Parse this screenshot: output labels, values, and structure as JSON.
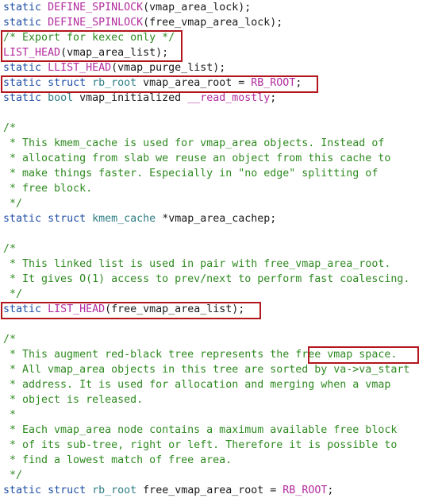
{
  "colors": {
    "keyword": "#1f4fa5",
    "macro": "#b22c9e",
    "type": "#2e7d84",
    "comment": "#2f8a21",
    "text": "#1a1a1a",
    "highlight_box": "#b3161d",
    "background": "#ffffff"
  },
  "lines": [
    [
      [
        "kw",
        "static"
      ],
      [
        "op",
        " "
      ],
      [
        "mac",
        "DEFINE_SPINLOCK"
      ],
      [
        "pn",
        "(vmap_area_lock);"
      ]
    ],
    [
      [
        "kw",
        "static"
      ],
      [
        "op",
        " "
      ],
      [
        "mac",
        "DEFINE_SPINLOCK"
      ],
      [
        "pn",
        "(free_vmap_area_lock);"
      ]
    ],
    [
      [
        "cmt",
        "/* Export for kexec only */"
      ]
    ],
    [
      [
        "mac",
        "LIST_HEAD"
      ],
      [
        "pn",
        "(vmap_area_list);"
      ]
    ],
    [
      [
        "kw",
        "static"
      ],
      [
        "op",
        " "
      ],
      [
        "mac",
        "LLIST_HEAD"
      ],
      [
        "pn",
        "(vmap_purge_list);"
      ]
    ],
    [
      [
        "kw",
        "static"
      ],
      [
        "op",
        " "
      ],
      [
        "kw",
        "struct"
      ],
      [
        "op",
        " "
      ],
      [
        "typ",
        "rb_root"
      ],
      [
        "pn",
        " vmap_area_root = "
      ],
      [
        "mac",
        "RB_ROOT"
      ],
      [
        "pn",
        ";"
      ]
    ],
    [
      [
        "kw",
        "static"
      ],
      [
        "op",
        " "
      ],
      [
        "typ",
        "bool"
      ],
      [
        "pn",
        " vmap_initialized "
      ],
      [
        "mac",
        "__read_mostly"
      ],
      [
        "pn",
        ";"
      ]
    ],
    [
      [
        "op",
        ""
      ]
    ],
    [
      [
        "cmt",
        "/*"
      ]
    ],
    [
      [
        "cmt",
        " * This kmem_cache is used for vmap_area objects. Instead of"
      ]
    ],
    [
      [
        "cmt",
        " * allocating from slab we reuse an object from this cache to"
      ]
    ],
    [
      [
        "cmt",
        " * make things faster. Especially in \"no edge\" splitting of"
      ]
    ],
    [
      [
        "cmt",
        " * free block."
      ]
    ],
    [
      [
        "cmt",
        " */"
      ]
    ],
    [
      [
        "kw",
        "static"
      ],
      [
        "op",
        " "
      ],
      [
        "kw",
        "struct"
      ],
      [
        "op",
        " "
      ],
      [
        "typ",
        "kmem_cache"
      ],
      [
        "pn",
        " *vmap_area_cachep;"
      ]
    ],
    [
      [
        "op",
        ""
      ]
    ],
    [
      [
        "cmt",
        "/*"
      ]
    ],
    [
      [
        "cmt",
        " * This linked list is used in pair with free_vmap_area_root."
      ]
    ],
    [
      [
        "cmt",
        " * It gives O(1) access to prev/next to perform fast coalescing."
      ]
    ],
    [
      [
        "cmt",
        " */"
      ]
    ],
    [
      [
        "kw",
        "static"
      ],
      [
        "op",
        " "
      ],
      [
        "mac",
        "LIST_HEAD"
      ],
      [
        "pn",
        "(free_vmap_area_list);"
      ]
    ],
    [
      [
        "op",
        ""
      ]
    ],
    [
      [
        "cmt",
        "/*"
      ]
    ],
    [
      [
        "cmt",
        " * This augment red-black tree represents the free vmap space."
      ]
    ],
    [
      [
        "cmt",
        " * All vmap_area objects in this tree are sorted by va->va_start"
      ]
    ],
    [
      [
        "cmt",
        " * address. It is used for allocation and merging when a vmap"
      ]
    ],
    [
      [
        "cmt",
        " * object is released."
      ]
    ],
    [
      [
        "cmt",
        " *"
      ]
    ],
    [
      [
        "cmt",
        " * Each vmap_area node contains a maximum available free block"
      ]
    ],
    [
      [
        "cmt",
        " * of its sub-tree, right or left. Therefore it is possible to"
      ]
    ],
    [
      [
        "cmt",
        " * find a lowest match of free area."
      ]
    ],
    [
      [
        "cmt",
        " */"
      ]
    ],
    [
      [
        "kw",
        "static"
      ],
      [
        "op",
        " "
      ],
      [
        "kw",
        "struct"
      ],
      [
        "op",
        " "
      ],
      [
        "typ",
        "rb_root"
      ],
      [
        "pn",
        " free_vmap_area_root = "
      ],
      [
        "mac",
        "RB_ROOT"
      ],
      [
        "pn",
        ";"
      ]
    ]
  ]
}
